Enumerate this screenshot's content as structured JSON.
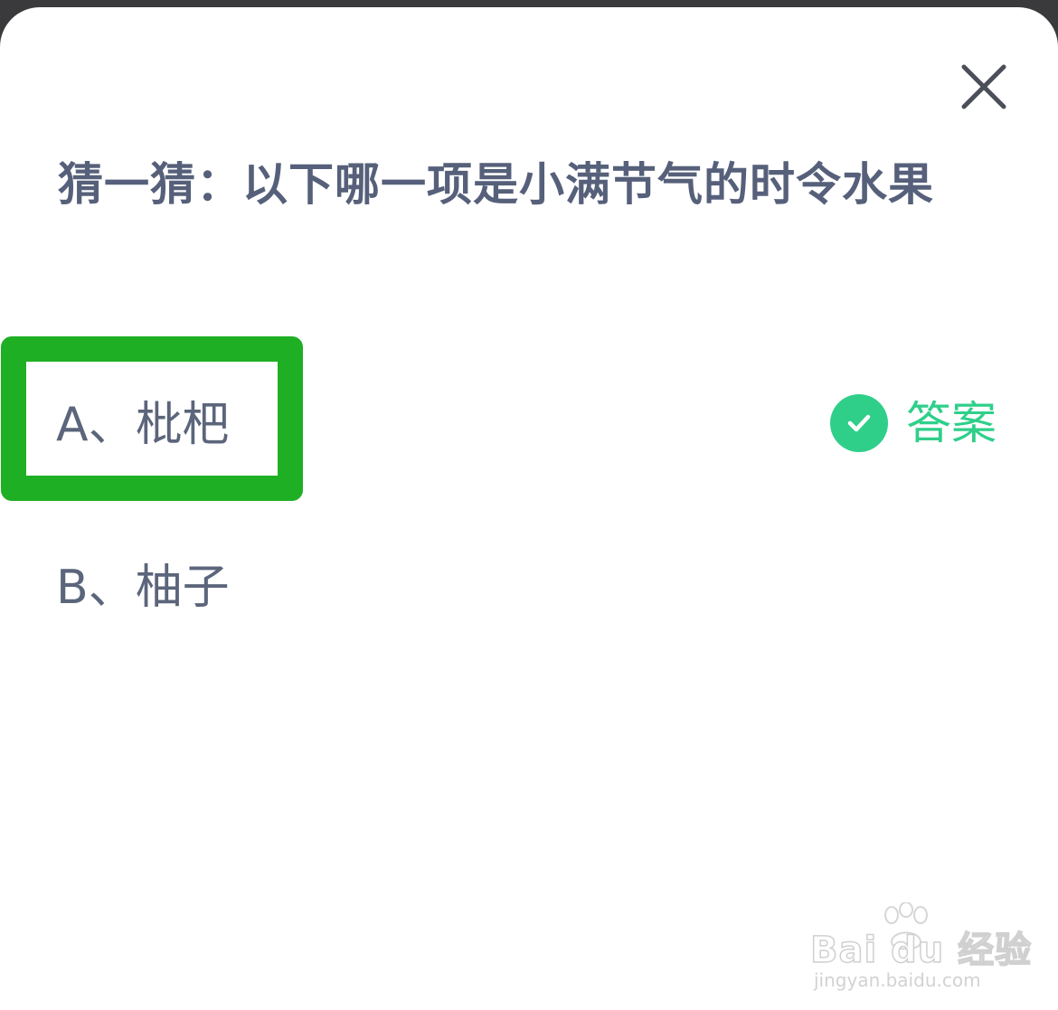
{
  "question": {
    "text": "猜一猜：以下哪一项是小满节气的时令水果"
  },
  "options": [
    {
      "label": "A、枇杷",
      "highlighted": true
    },
    {
      "label": "B、柚子",
      "highlighted": false
    }
  ],
  "answer": {
    "label": "答案",
    "icon": "check-circle-icon"
  },
  "close": {
    "icon": "close-icon"
  },
  "watermark": {
    "brand": "Bai du 经验",
    "url": "jingyan.baidu.com"
  },
  "colors": {
    "highlight_border": "#1faf24",
    "answer_green": "#2fcf8a",
    "question_text": "#56607a",
    "option_text": "#5b657b"
  }
}
